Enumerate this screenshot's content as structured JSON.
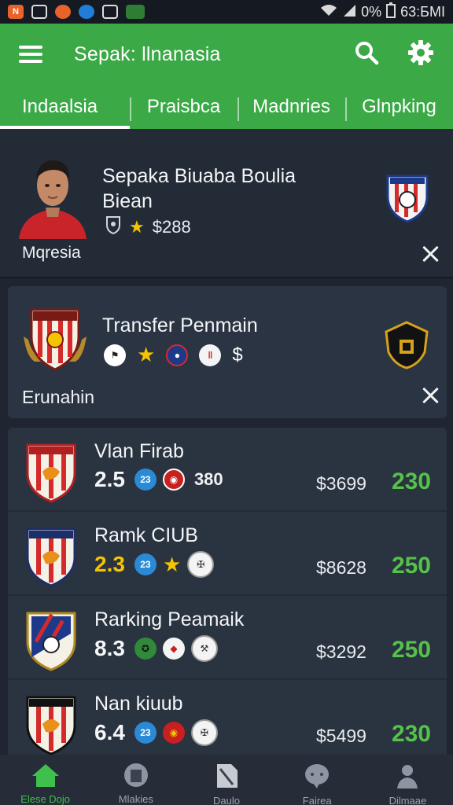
{
  "status_bar": {
    "battery": "0%",
    "time": "63:БMI",
    "colors": {
      "orange": "#e8632a",
      "blue": "#1f7fd6",
      "green": "#2e7d32"
    }
  },
  "header": {
    "title": "Sepak: llnanasia",
    "accent": "#3aa946",
    "tabs": [
      "Indaalsia",
      "Praisbca",
      "Madnries",
      "Glnpking"
    ],
    "active_tab": 0
  },
  "news_card": {
    "title": "Sepaka Biuaba Boulia Biean",
    "price": "$288",
    "caption": "Mqresia"
  },
  "transfer_card": {
    "title": "Transfer Penmain",
    "currency_symbol": "$",
    "caption": "Erunahin"
  },
  "clubs": [
    {
      "name": "Vlan Firab",
      "rating": "2.5",
      "chip_label": "23",
      "extra": "380",
      "price": "$3699",
      "points": "230",
      "rating_gold": false
    },
    {
      "name": "Ramk CIUB",
      "rating": "2.3",
      "chip_label": "23",
      "extra": "",
      "price": "$8628",
      "points": "250",
      "rating_gold": true
    },
    {
      "name": "Rarking Peamaik",
      "rating": "8.3",
      "chip_label": "",
      "extra": "",
      "price": "$3292",
      "points": "250",
      "rating_gold": false
    },
    {
      "name": "Nan kiuub",
      "rating": "6.4",
      "chip_label": "23",
      "extra": "",
      "price": "$5499",
      "points": "230",
      "rating_gold": false
    }
  ],
  "bottom_nav": [
    {
      "label": "Elese Dojo",
      "icon": "home-icon"
    },
    {
      "label": "Mlakies",
      "icon": "robot-icon"
    },
    {
      "label": "Daulo",
      "icon": "document-icon"
    },
    {
      "label": "Fairea",
      "icon": "chat-icon"
    },
    {
      "label": "Dilmaae",
      "icon": "person-icon"
    }
  ]
}
